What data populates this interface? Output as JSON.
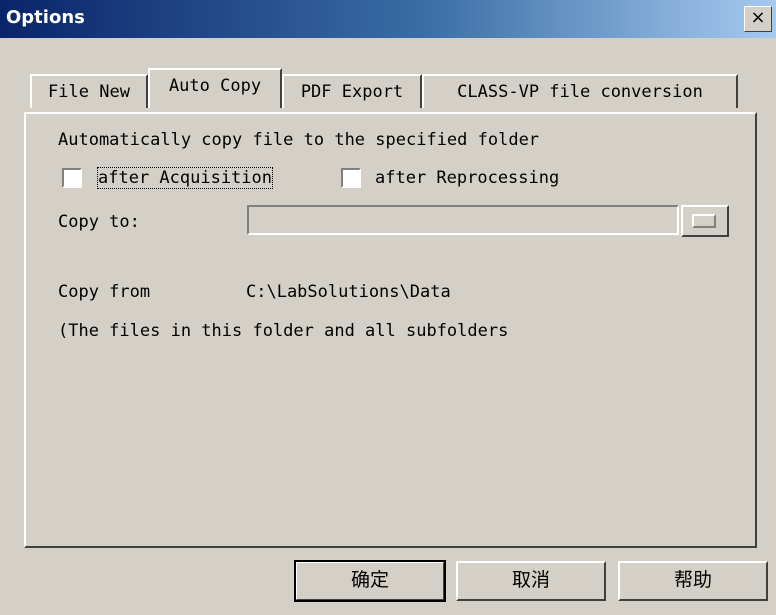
{
  "window": {
    "title": "Options",
    "close_label": "×"
  },
  "tabs": [
    {
      "label": "File New"
    },
    {
      "label": "Auto Copy"
    },
    {
      "label": "PDF Export"
    },
    {
      "label": "CLASS-VP file conversion"
    }
  ],
  "auto_copy": {
    "heading": "Automatically copy file to the specified folder",
    "after_acquisition": {
      "label": "after Acquisition",
      "checked": false
    },
    "after_reprocessing": {
      "label": "after Reprocessing",
      "checked": false
    },
    "copy_to_label": "Copy to:",
    "copy_to_value": "",
    "copy_from_label": "Copy from",
    "copy_from_value": "C:\\LabSolutions\\Data",
    "note": "(The files in this folder and all subfolders"
  },
  "buttons": {
    "ok": "确定",
    "cancel": "取消",
    "help": "帮助"
  }
}
